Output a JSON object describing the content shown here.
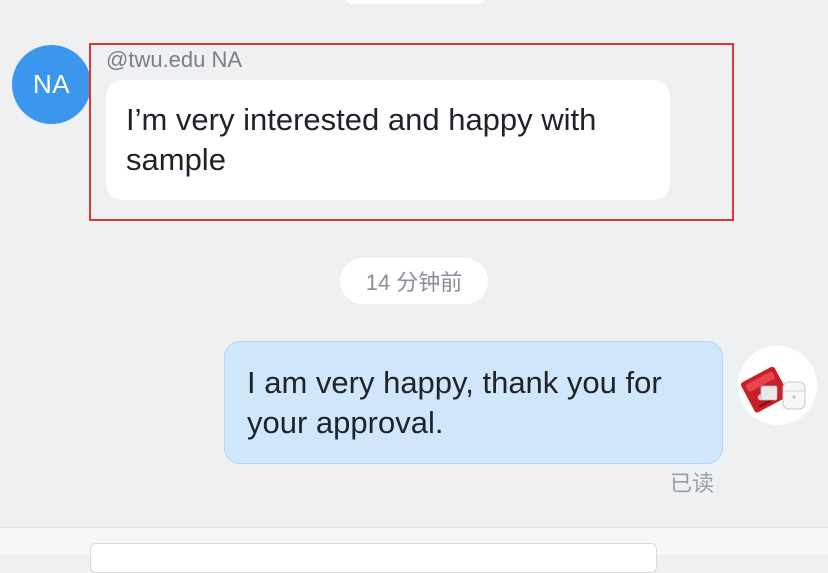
{
  "incoming_message": {
    "avatar_initials": "NA",
    "sender": "@twu.edu NA",
    "text": "I’m very interested and happy with sample"
  },
  "timestamp": "14 分钟前",
  "outgoing_message": {
    "text": "I am very happy, thank you for your approval.",
    "status": "已读",
    "avatar_icon": "product-photo-avatar"
  },
  "colors": {
    "background": "#eef0f2",
    "incoming_bubble": "#ffffff",
    "outgoing_bubble": "#cfe6fb",
    "avatar_blue": "#3b96ee",
    "highlight": "#e5342f"
  }
}
